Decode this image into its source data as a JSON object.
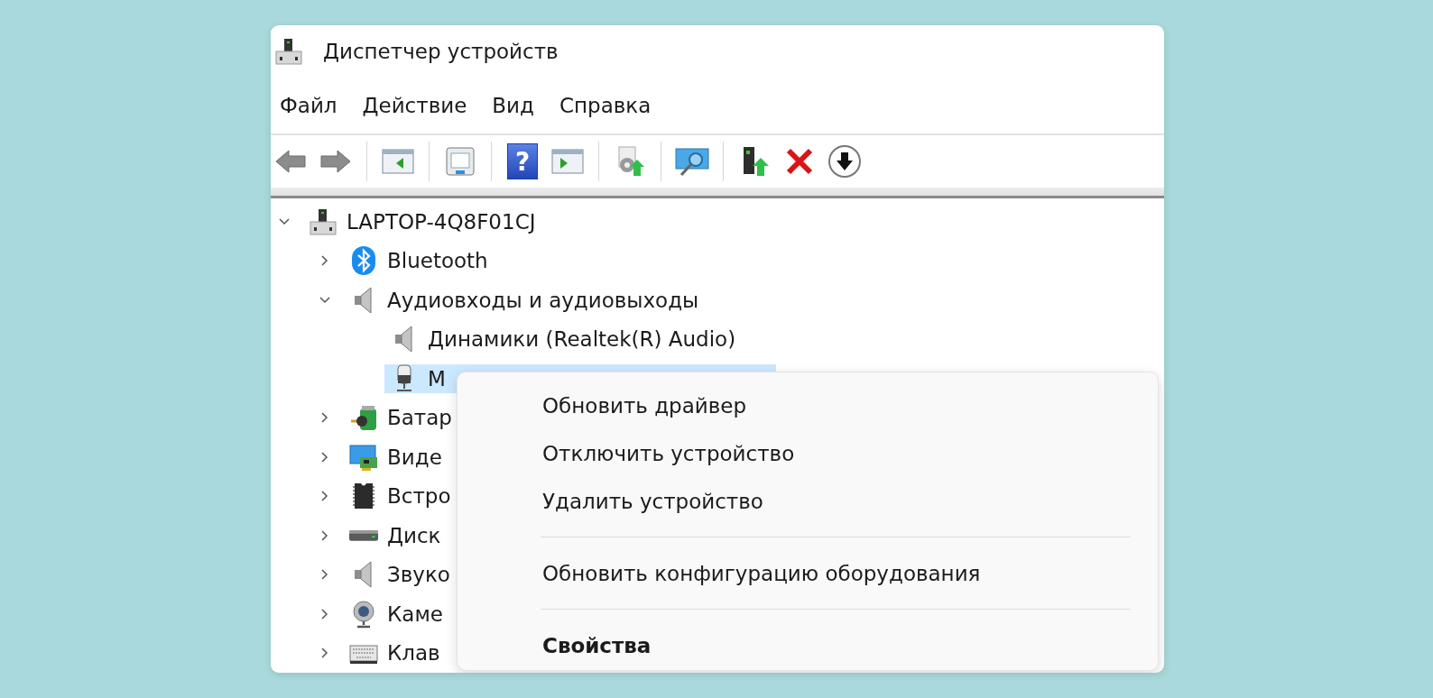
{
  "window": {
    "title": "Диспетчер устройств"
  },
  "menu_bar": [
    "Файл",
    "Действие",
    "Вид",
    "Справка"
  ],
  "toolbar": [
    {
      "kind": "back"
    },
    {
      "kind": "forward"
    },
    {
      "kind": "separator"
    },
    {
      "kind": "panel-left"
    },
    {
      "kind": "separator"
    },
    {
      "kind": "sheet"
    },
    {
      "kind": "separator"
    },
    {
      "kind": "help",
      "glyph": "?"
    },
    {
      "kind": "panel-right"
    },
    {
      "kind": "separator"
    },
    {
      "kind": "gear-up"
    },
    {
      "kind": "separator"
    },
    {
      "kind": "monitor-search"
    },
    {
      "kind": "separator"
    },
    {
      "kind": "tower-up"
    },
    {
      "kind": "delete"
    },
    {
      "kind": "download"
    }
  ],
  "tree": [
    {
      "label": "LAPTOP-4Q8F01CJ",
      "kind": "computer",
      "expanded": true,
      "selected": false,
      "children": [
        {
          "label": "Bluetooth",
          "kind": "bluetooth",
          "expanded": false,
          "selected": false
        },
        {
          "label": "Аудиовходы и аудиовыходы",
          "kind": "speaker",
          "expanded": true,
          "selected": false,
          "children": [
            {
              "label": "Динамики (Realtek(R) Audio)",
              "kind": "speaker",
              "selected": false
            },
            {
              "label": "М",
              "kind": "microphone",
              "selected": true
            }
          ]
        },
        {
          "label": "Батар",
          "kind": "battery",
          "expanded": false,
          "selected": false
        },
        {
          "label": "Виде",
          "kind": "display",
          "expanded": false,
          "selected": false
        },
        {
          "label": "Встро",
          "kind": "chip",
          "expanded": false,
          "selected": false
        },
        {
          "label": "Диск",
          "kind": "disk",
          "expanded": false,
          "selected": false
        },
        {
          "label": "Звуко",
          "kind": "speaker",
          "expanded": false,
          "selected": false
        },
        {
          "label": "Каме",
          "kind": "camera",
          "expanded": false,
          "selected": false
        },
        {
          "label": "Клав",
          "kind": "keyboard",
          "expanded": false,
          "selected": false
        }
      ]
    }
  ],
  "context_menu": [
    {
      "kind": "command",
      "label": "Обновить драйвер",
      "default": false
    },
    {
      "kind": "command",
      "label": "Отключить устройство",
      "default": false
    },
    {
      "kind": "command",
      "label": "Удалить устройство",
      "default": false
    },
    {
      "kind": "separator"
    },
    {
      "kind": "command",
      "label": "Обновить конфигурацию оборудования",
      "default": false
    },
    {
      "kind": "separator"
    },
    {
      "kind": "command",
      "label": "Свойства",
      "default": true
    }
  ]
}
